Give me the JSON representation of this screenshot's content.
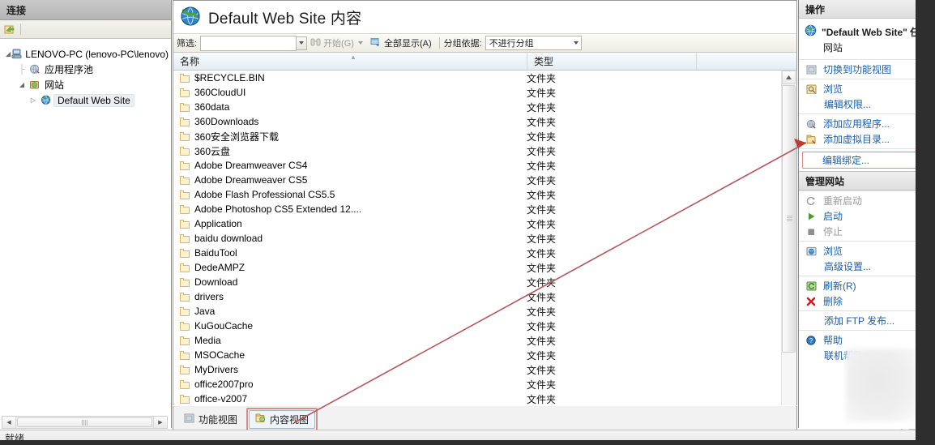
{
  "left_pane": {
    "header": "连接",
    "toolbar_icon": "connect-icon",
    "tree": [
      {
        "label": "LENOVO-PC (lenovo-PC\\lenovo)",
        "level": 1,
        "icon": "server-icon",
        "twisty": "▲",
        "selected": false
      },
      {
        "label": "应用程序池",
        "level": 2,
        "icon": "app-pool-icon",
        "twisty": "",
        "selected": false
      },
      {
        "label": "网站",
        "level": 2,
        "icon": "sites-folder-icon",
        "twisty": "▲",
        "selected": false
      },
      {
        "label": "Default Web Site",
        "level": 3,
        "icon": "website-globe-icon",
        "twisty": "▶",
        "selected": true
      }
    ]
  },
  "center": {
    "title": "Default Web Site 内容",
    "title_icon": "globe-icon",
    "filter": {
      "label": "筛选:",
      "value": "",
      "placeholder": "",
      "go_button": "开始(G)",
      "show_all_button": "全部显示(A)",
      "group_by_label": "分组依据:",
      "group_by_value": "不进行分组"
    },
    "columns": [
      {
        "key": "name",
        "label": "名称",
        "sorted": "asc"
      },
      {
        "key": "type",
        "label": "类型",
        "sorted": ""
      }
    ],
    "rows": [
      {
        "name": "$RECYCLE.BIN",
        "type": "文件夹"
      },
      {
        "name": "360CloudUI",
        "type": "文件夹"
      },
      {
        "name": "360data",
        "type": "文件夹"
      },
      {
        "name": "360Downloads",
        "type": "文件夹"
      },
      {
        "name": "360安全浏览器下载",
        "type": "文件夹"
      },
      {
        "name": "360云盘",
        "type": "文件夹"
      },
      {
        "name": "Adobe Dreamweaver CS4",
        "type": "文件夹"
      },
      {
        "name": "Adobe Dreamweaver CS5",
        "type": "文件夹"
      },
      {
        "name": "Adobe Flash Professional CS5.5",
        "type": "文件夹"
      },
      {
        "name": "Adobe Photoshop CS5 Extended 12....",
        "type": "文件夹"
      },
      {
        "name": "Application",
        "type": "文件夹"
      },
      {
        "name": "baidu download",
        "type": "文件夹"
      },
      {
        "name": "BaiduTool",
        "type": "文件夹"
      },
      {
        "name": "DedeAMPZ",
        "type": "文件夹"
      },
      {
        "name": "Download",
        "type": "文件夹"
      },
      {
        "name": "drivers",
        "type": "文件夹"
      },
      {
        "name": "Java",
        "type": "文件夹"
      },
      {
        "name": "KuGouCache",
        "type": "文件夹"
      },
      {
        "name": "Media",
        "type": "文件夹"
      },
      {
        "name": "MSOCache",
        "type": "文件夹"
      },
      {
        "name": "MyDrivers",
        "type": "文件夹"
      },
      {
        "name": "office2007pro",
        "type": "文件夹"
      },
      {
        "name": "office-v2007",
        "type": "文件夹"
      }
    ],
    "view_tabs": [
      {
        "label": "功能视图",
        "icon": "feature-view-icon",
        "active": false,
        "highlighted": false
      },
      {
        "label": "内容视图",
        "icon": "content-view-icon",
        "active": true,
        "highlighted": true
      }
    ]
  },
  "right_pane": {
    "header": "操作",
    "task_title": "\"Default Web Site\" 任务",
    "task_subtitle": "网站",
    "groups": [
      {
        "items": [
          {
            "label": "切换到功能视图",
            "icon": "switch-view-icon",
            "style": "link",
            "highlighted": false
          }
        ]
      },
      {
        "items": [
          {
            "label": "浏览",
            "icon": "browse-icon",
            "style": "link",
            "highlighted": false
          },
          {
            "label": "编辑权限...",
            "icon": "",
            "style": "link-indent",
            "highlighted": false
          }
        ]
      },
      {
        "items": [
          {
            "label": "添加应用程序...",
            "icon": "add-application-icon",
            "style": "link",
            "highlighted": false
          },
          {
            "label": "添加虚拟目录...",
            "icon": "add-virtual-directory-icon",
            "style": "link",
            "highlighted": false
          }
        ]
      },
      {
        "items": [
          {
            "label": "编辑绑定...",
            "icon": "",
            "style": "link-indent",
            "highlighted": true
          }
        ]
      }
    ],
    "manage_section": {
      "header": "管理网站",
      "collapse_icon": "chevron-up-icon",
      "groups": [
        {
          "items": [
            {
              "label": "重新启动",
              "icon": "restart-icon",
              "style": "dim",
              "highlighted": false
            },
            {
              "label": "启动",
              "icon": "start-icon",
              "style": "link",
              "highlighted": false
            },
            {
              "label": "停止",
              "icon": "stop-icon",
              "style": "dim",
              "highlighted": false
            }
          ]
        },
        {
          "items": [
            {
              "label": "浏览",
              "icon": "browse-site-icon",
              "style": "link",
              "highlighted": false
            },
            {
              "label": "高级设置...",
              "icon": "",
              "style": "link-indent",
              "highlighted": false
            }
          ]
        },
        {
          "items": [
            {
              "label": "刷新(R)",
              "icon": "refresh-icon",
              "style": "link",
              "highlighted": false
            },
            {
              "label": "删除",
              "icon": "delete-icon",
              "style": "link",
              "highlighted": false
            }
          ]
        },
        {
          "items": [
            {
              "label": "添加 FTP 发布...",
              "icon": "",
              "style": "link-indent",
              "highlighted": false
            }
          ]
        },
        {
          "items": [
            {
              "label": "帮助",
              "icon": "help-icon",
              "style": "link",
              "highlighted": false
            },
            {
              "label": "联机帮助",
              "icon": "",
              "style": "link-indent",
              "highlighted": false
            }
          ]
        }
      ]
    }
  },
  "status_bar": {
    "text": "就绪"
  },
  "annotation": {
    "arrow_color": "#b4595c",
    "highlight_color": "#d98c8c",
    "from": "内容视图",
    "to": "编辑绑定..."
  }
}
